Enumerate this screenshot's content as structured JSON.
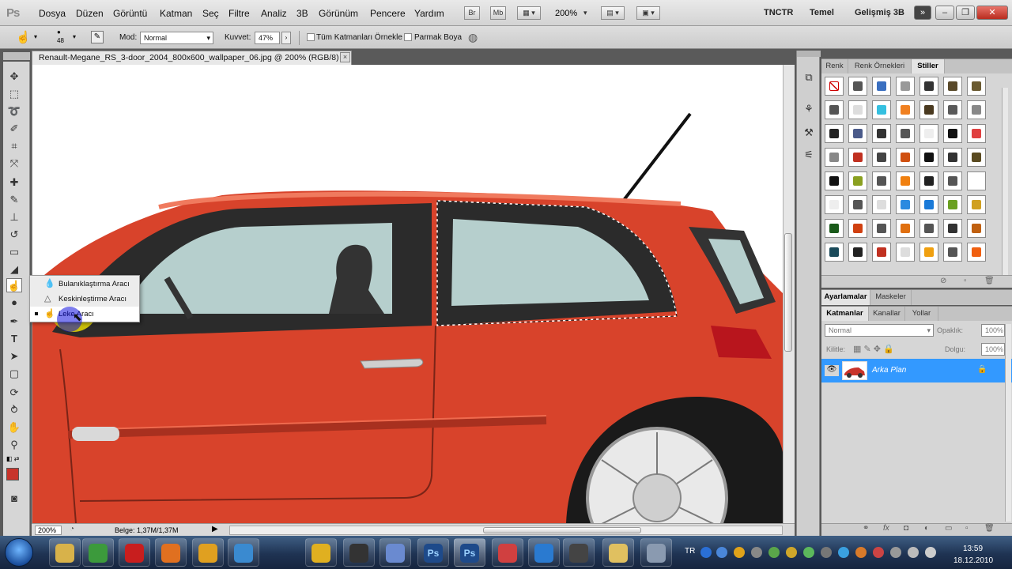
{
  "app": {
    "logo": "Ps",
    "menu": [
      "Dosya",
      "Düzen",
      "Görüntü",
      "Katman",
      "Seç",
      "Filtre",
      "Analiz",
      "3B",
      "Görünüm",
      "Pencere",
      "Yardım"
    ],
    "bridge_btn": "Br",
    "minibridge_btn": "Mb",
    "zoom": "200%",
    "workspaces": [
      "TNCTR",
      "Temel",
      "Gelişmiş 3B"
    ]
  },
  "options": {
    "brush_size": "48",
    "mode_label": "Mod:",
    "mode_value": "Normal",
    "strength_label": "Kuvvet:",
    "strength_value": "47%",
    "sample_all_label": "Tüm Katmanları Örnekle",
    "finger_paint_label": "Parmak Boya"
  },
  "document": {
    "tab_title": "Renault-Megane_RS_3-door_2004_800x600_wallpaper_06.jpg @ 200% (RGB/8)",
    "close": "×",
    "status_zoom": "200%",
    "status_info": "Belge: 1,37M/1,37M"
  },
  "flyout": {
    "items": [
      {
        "label": "Bulanıklaştırma Aracı",
        "icon": "blur-drop-icon"
      },
      {
        "label": "Keskinleştirme Aracı",
        "icon": "sharpen-triangle-icon"
      },
      {
        "label": "Leke Aracı",
        "icon": "smudge-finger-icon",
        "selected": true
      }
    ]
  },
  "styles_panel": {
    "tabs": [
      "Renk",
      "Renk Örnekleri",
      "Stiller"
    ],
    "active_tab": "Stiller"
  },
  "adjust_panel": {
    "tabs": [
      "Ayarlamalar",
      "Maskeler"
    ]
  },
  "layers_panel": {
    "tabs": [
      "Katmanlar",
      "Kanallar",
      "Yollar"
    ],
    "blend_mode": "Normal",
    "opacity_label": "Opaklık:",
    "opacity_value": "100%",
    "lock_label": "Kilitle:",
    "fill_label": "Dolgu:",
    "fill_value": "100%",
    "layers": [
      {
        "name": "Arka Plan",
        "visible": true,
        "locked": true
      }
    ]
  },
  "taskbar": {
    "apps": [
      {
        "name": "file-explorer",
        "label": ""
      },
      {
        "name": "chrome",
        "label": ""
      },
      {
        "name": "opera",
        "label": ""
      },
      {
        "name": "firefox",
        "label": ""
      },
      {
        "name": "media-player",
        "label": ""
      },
      {
        "name": "messenger",
        "label": ""
      },
      {
        "name": "utility",
        "label": ""
      },
      {
        "name": "obs",
        "label": ""
      },
      {
        "name": "paint",
        "label": ""
      },
      {
        "name": "photoshop-1",
        "label": "Ps"
      },
      {
        "name": "photoshop-2",
        "label": "Ps"
      },
      {
        "name": "app-11",
        "label": ""
      },
      {
        "name": "app-12",
        "label": ""
      },
      {
        "name": "counter-strike",
        "label": ""
      },
      {
        "name": "folder",
        "label": ""
      },
      {
        "name": "app-16",
        "label": ""
      }
    ],
    "lang": "TR",
    "time": "13:59",
    "date": "18.12.2010"
  },
  "colors": {
    "car_body": "#d8432b",
    "car_shadow": "#a8301f",
    "glass": "#b6cfcd",
    "layer_selected": "#3399ff",
    "fg_color": "#c8342b"
  }
}
